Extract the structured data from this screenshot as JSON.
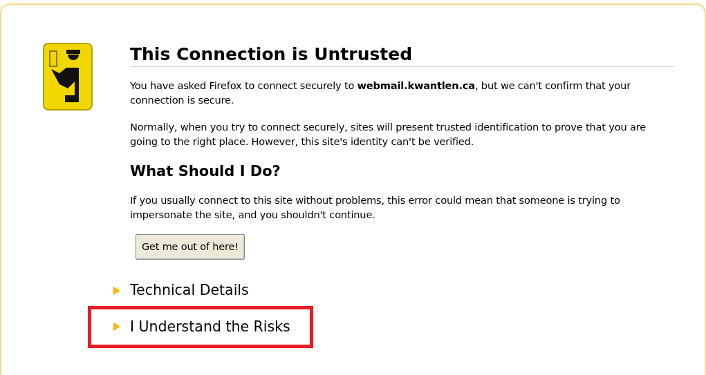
{
  "title": "This Connection is Untrusted",
  "intro": [
    "You have asked Firefox to connect securely to **webmail.kwantlen.ca**, but we can't confirm that your connection is secure.",
    "Normally, when you try to connect securely, sites will present trusted identification to prove that you are going to the right place. However, this site's identity can't be verified."
  ],
  "what_to_do": {
    "heading": "What Should I Do?",
    "text": "If you usually connect to this site without problems, this error could mean that someone is trying to impersonate the site, and you shouldn't continue.",
    "button": "Get me out of here!"
  },
  "expanders": [
    {
      "label": "Technical Details",
      "expanded": false,
      "highlighted": false
    },
    {
      "label": "I Understand the Risks",
      "expanded": false,
      "highlighted": true
    }
  ]
}
